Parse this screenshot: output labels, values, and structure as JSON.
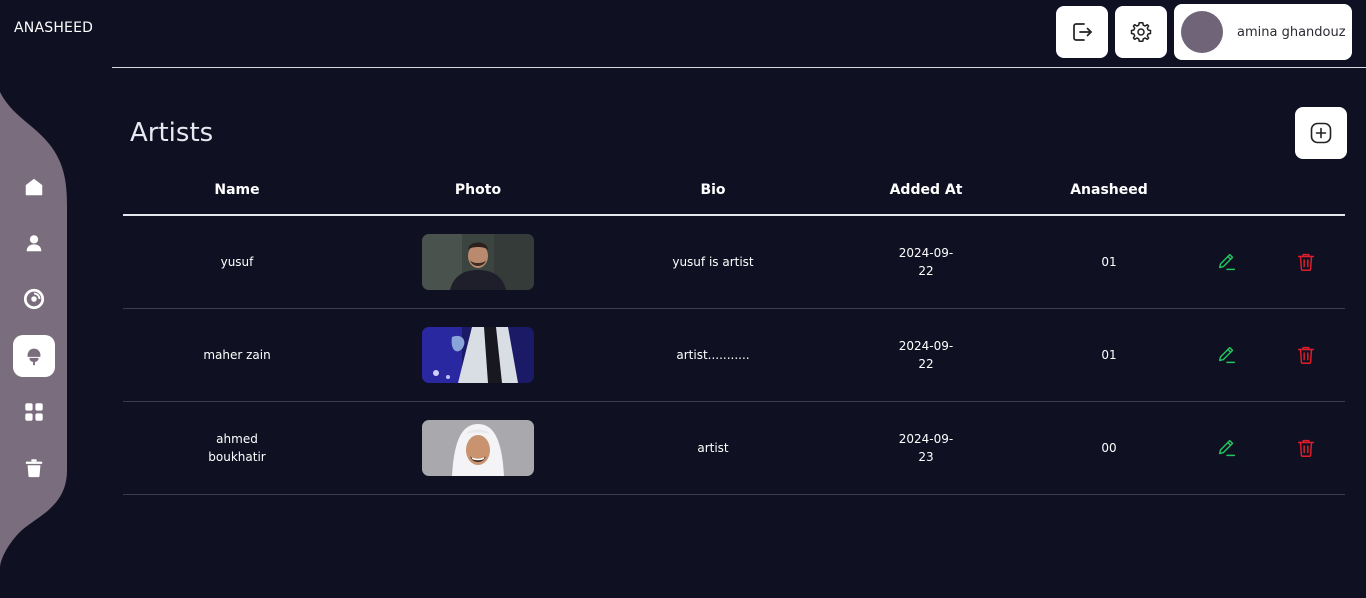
{
  "app": {
    "brand": "ANASHEED"
  },
  "header": {
    "user_name": "amina ghandouz"
  },
  "page": {
    "title": "Artists"
  },
  "table": {
    "columns": [
      "Name",
      "Photo",
      "Bio",
      "Added At",
      "Anasheed"
    ],
    "rows": [
      {
        "name": "yusuf",
        "bio": "yusuf is artist",
        "added_at": "2024-09-22",
        "date_line1": "2024-09-",
        "date_line2": "22",
        "anasheed": "01"
      },
      {
        "name": "maher zain",
        "bio": "artist...........",
        "added_at": "2024-09-22",
        "date_line1": "2024-09-",
        "date_line2": "22",
        "anasheed": "01"
      },
      {
        "name": "ahmed boukhatir",
        "bio": "artist",
        "added_at": "2024-09-23",
        "date_line1": "2024-09-",
        "date_line2": "23",
        "anasheed": "00"
      }
    ]
  },
  "sidebar": {
    "items": [
      {
        "icon": "home-icon",
        "active": false
      },
      {
        "icon": "user-icon",
        "active": false
      },
      {
        "icon": "disc-icon",
        "active": false
      },
      {
        "icon": "microphone-icon",
        "active": true
      },
      {
        "icon": "grid-icon",
        "active": false
      },
      {
        "icon": "trash-icon",
        "active": false
      }
    ]
  },
  "colors": {
    "background": "#0f1123",
    "sidebar": "#7a6d7d",
    "edit": "#22c55e",
    "delete": "#e11d2a"
  }
}
